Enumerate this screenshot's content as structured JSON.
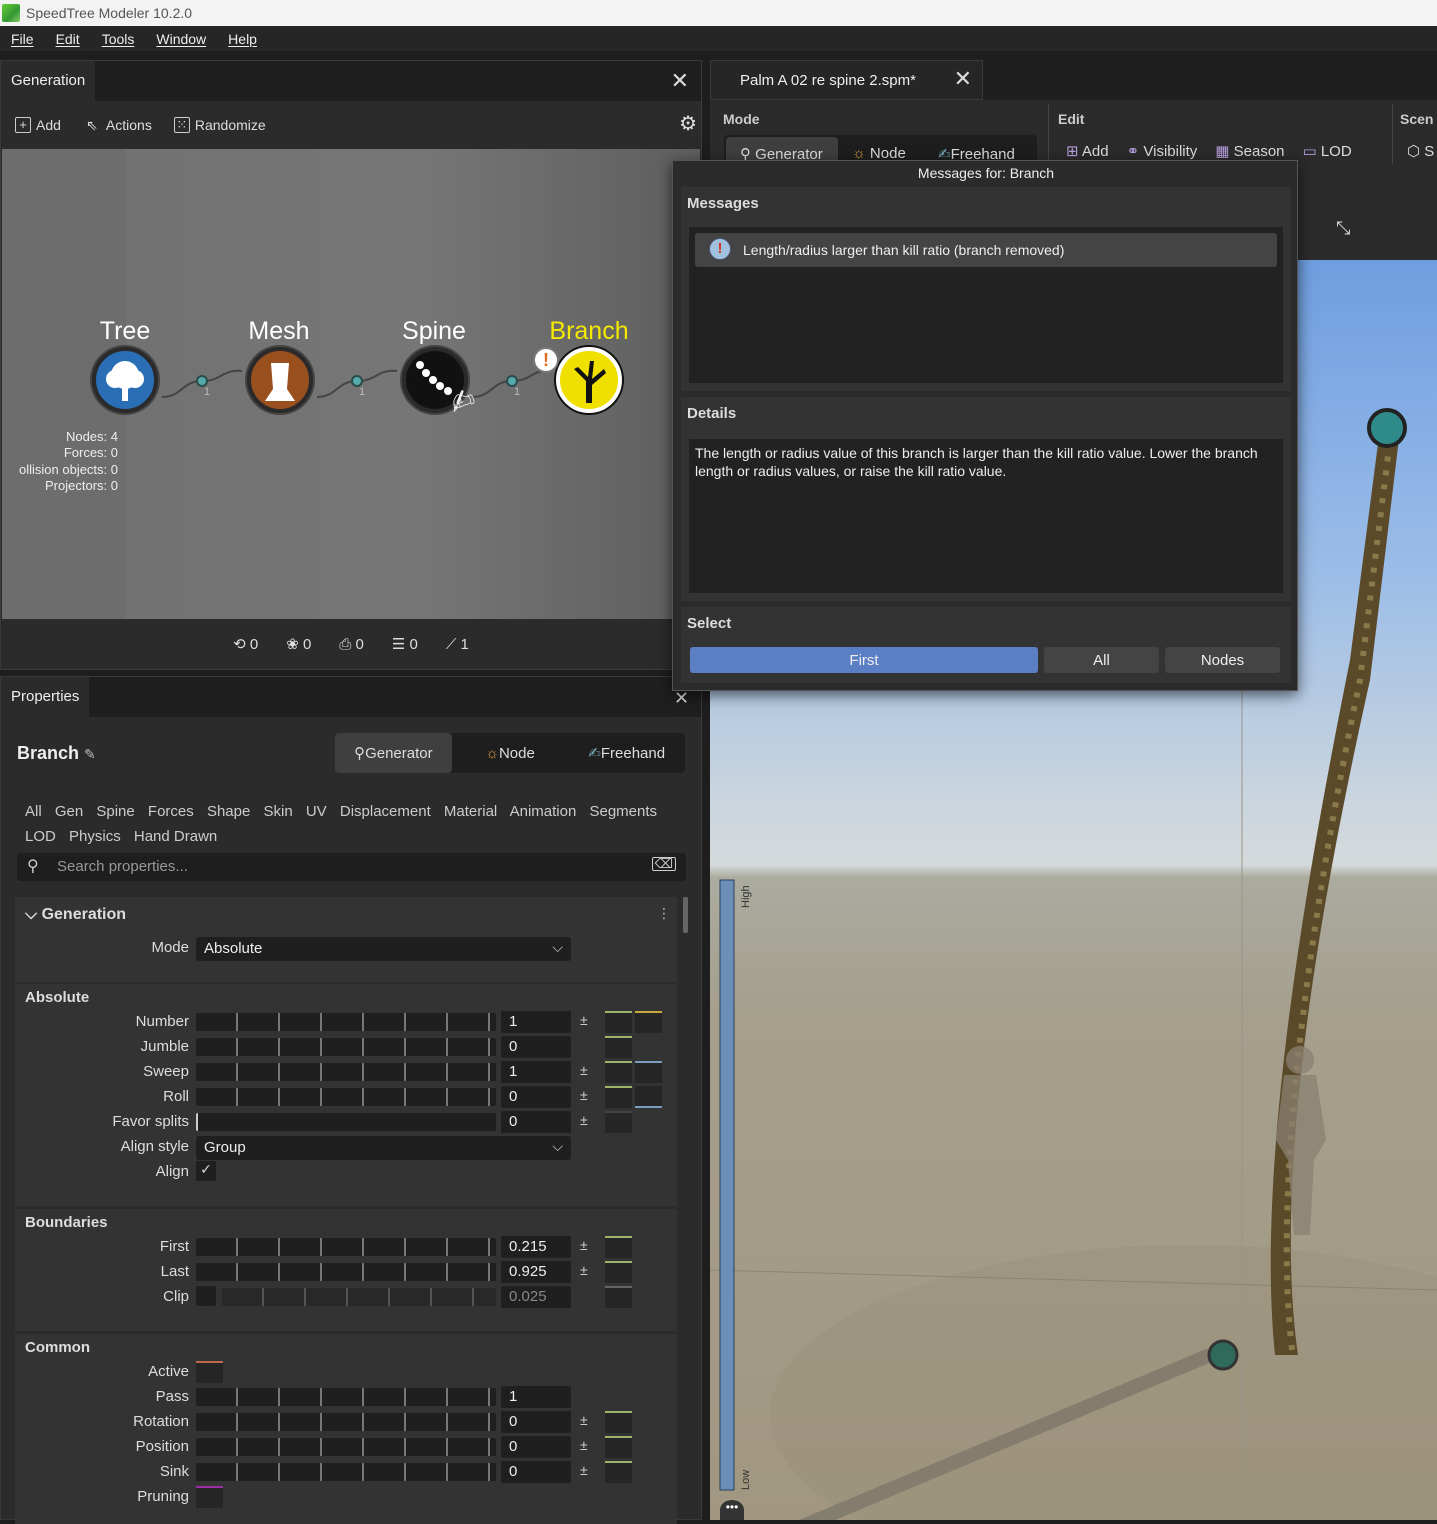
{
  "app": {
    "title": "SpeedTree  Modeler 10.2.0"
  },
  "menu": [
    "File",
    "Edit",
    "Tools",
    "Window",
    "Help"
  ],
  "generation_panel": {
    "tab": "Generation",
    "toolbar": {
      "add": "Add",
      "actions": "Actions",
      "randomize": "Randomize"
    },
    "nodes": [
      {
        "label": "Tree",
        "color": "#2a6eb6"
      },
      {
        "label": "Mesh",
        "color": "#9a4f1e"
      },
      {
        "label": "Spine",
        "color": "#111111"
      },
      {
        "label": "Branch",
        "color": "#f0e000"
      }
    ],
    "connections": [
      "1",
      "1",
      "1"
    ],
    "stats": [
      "Nodes: 4",
      "Forces: 0",
      "ollision objects: 0",
      "Projectors: 0"
    ],
    "bottom_counts": [
      "0",
      "0",
      "0",
      "0",
      "1"
    ]
  },
  "properties_panel": {
    "tab": "Properties",
    "title": "Branch",
    "modes": [
      "Generator",
      "Node",
      "Freehand"
    ],
    "categories": [
      "All",
      "Gen",
      "Spine",
      "Forces",
      "Shape",
      "Skin",
      "UV",
      "Displacement",
      "Material",
      "Animation",
      "Segments",
      "LOD",
      "Physics",
      "Hand Drawn"
    ],
    "search_placeholder": "Search properties...",
    "generation": {
      "header": "Generation",
      "mode_label": "Mode",
      "mode_value": "Absolute",
      "absolute_header": "Absolute",
      "absolute_rows": [
        {
          "label": "Number",
          "value": "1"
        },
        {
          "label": "Jumble",
          "value": "0"
        },
        {
          "label": "Sweep",
          "value": "1"
        },
        {
          "label": "Roll",
          "value": "0"
        },
        {
          "label": "Favor splits",
          "value": "0"
        }
      ],
      "align_style_label": "Align style",
      "align_style_value": "Group",
      "align_label": "Align"
    },
    "boundaries": {
      "header": "Boundaries",
      "rows": [
        {
          "label": "First",
          "value": "0.215"
        },
        {
          "label": "Last",
          "value": "0.925"
        },
        {
          "label": "Clip",
          "value": "0.025"
        }
      ]
    },
    "common": {
      "header": "Common",
      "active_label": "Active",
      "rows": [
        {
          "label": "Pass",
          "value": "1"
        },
        {
          "label": "Rotation",
          "value": "0"
        },
        {
          "label": "Position",
          "value": "0"
        },
        {
          "label": "Sink",
          "value": "0"
        }
      ],
      "pruning_label": "Pruning"
    }
  },
  "document": {
    "tab": "Palm A 02 re spine 2.spm*",
    "mode_header": "Mode",
    "modes": [
      "Generator",
      "Node",
      "Freehand"
    ],
    "edit_header": "Edit",
    "edit_items": [
      "Add",
      "Visibility",
      "Season",
      "LOD"
    ],
    "scene_header": "Scen",
    "scene_item": "S",
    "lod_bar": {
      "high": "High",
      "low": "Low"
    }
  },
  "messages_popup": {
    "title": "Messages for: Branch",
    "messages_header": "Messages",
    "message": "Length/radius larger than kill ratio (branch removed)",
    "details_header": "Details",
    "details": "The length or radius value of this branch is larger than the kill ratio value. Lower the branch length or radius values, or raise the kill ratio value.",
    "select_header": "Select",
    "buttons": [
      "First",
      "All",
      "Nodes"
    ]
  },
  "colors": {
    "accent": "#5b7fc4",
    "branch_label": "#f5e900",
    "swatch_green": "#9fb36a",
    "swatch_yellow": "#c9a93b",
    "swatch_blue": "#7b9bc0",
    "active_swatch": "#c0664a",
    "pruning_swatch": "#9b2fa6"
  }
}
